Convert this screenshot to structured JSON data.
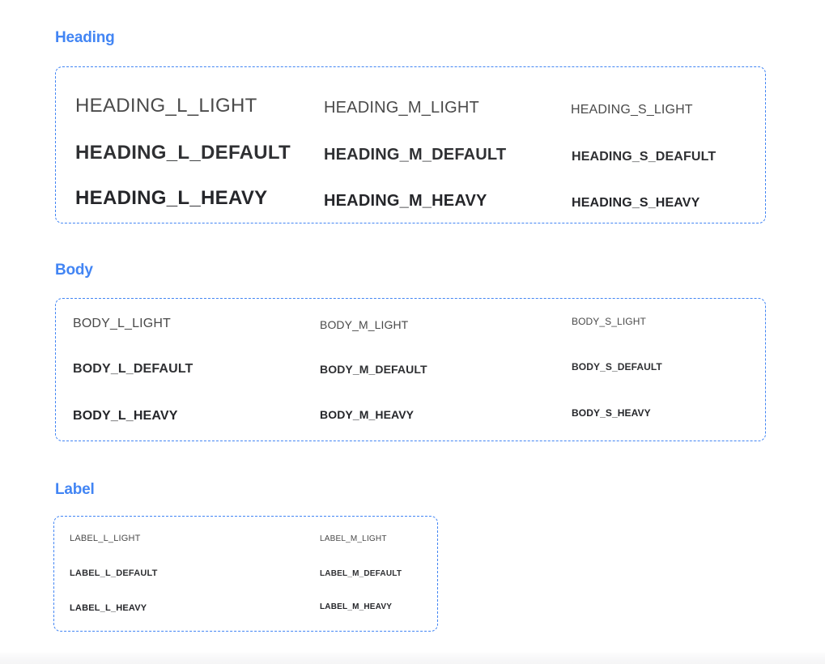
{
  "page": {
    "background_color": "#ffffff",
    "accent_color": "#4285f4"
  },
  "sections": [
    {
      "id": "heading",
      "title": "Heading",
      "columns": [
        "L",
        "M",
        "S"
      ],
      "rows": [
        {
          "weight": "light",
          "cells": [
            "HEADING_L_LIGHT",
            "HEADING_M_LIGHT",
            "HEADING_S_LIGHT"
          ]
        },
        {
          "weight": "default",
          "cells": [
            "HEADING_L_DEFAULT",
            "HEADING_M_DEFAULT",
            "HEADING_S_DEAFULT"
          ]
        },
        {
          "weight": "heavy",
          "cells": [
            "HEADING_L_HEAVY",
            "HEADING_M_HEAVY",
            "HEADING_S_HEAVY"
          ]
        }
      ]
    },
    {
      "id": "body",
      "title": "Body",
      "columns": [
        "L",
        "M",
        "S"
      ],
      "rows": [
        {
          "weight": "light",
          "cells": [
            "BODY_L_LIGHT",
            "BODY_M_LIGHT",
            "BODY_S_LIGHT"
          ]
        },
        {
          "weight": "default",
          "cells": [
            "BODY_L_DEFAULT",
            "BODY_M_DEFAULT",
            "BODY_S_DEFAULT"
          ]
        },
        {
          "weight": "heavy",
          "cells": [
            "BODY_L_HEAVY",
            "BODY_M_HEAVY",
            "BODY_S_HEAVY"
          ]
        }
      ]
    },
    {
      "id": "label",
      "title": "Label",
      "columns": [
        "L",
        "M"
      ],
      "rows": [
        {
          "weight": "light",
          "cells": [
            "LABEL_L_LIGHT",
            "LABEL_M_LIGHT"
          ]
        },
        {
          "weight": "default",
          "cells": [
            "LABEL_L_DEFAULT",
            "LABEL_M_DEFAULT"
          ]
        },
        {
          "weight": "heavy",
          "cells": [
            "LABEL_L_HEAVY",
            "LABEL_M_HEAVY"
          ]
        }
      ]
    }
  ]
}
